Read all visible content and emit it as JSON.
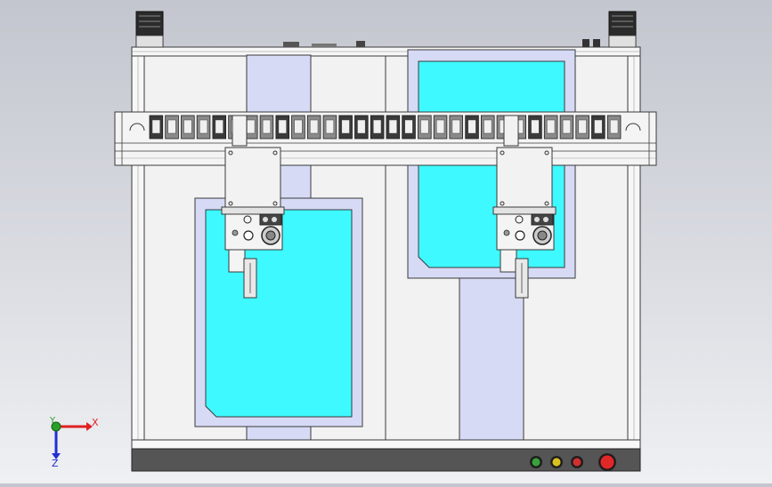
{
  "viewport": {
    "background": "#d4d6dc",
    "frame_color": "#f2f2f2",
    "outline_color": "#3a3a3a",
    "tray_fill": "#d7daf5",
    "work_fill": "#3ef9ff",
    "plate_fill": "#e9e9e9",
    "base_fill": "#555555"
  },
  "triad": {
    "x_label": "X",
    "z_label": "Z",
    "y_label": "Y",
    "x_color": "#e02020",
    "y_color": "#2aa02a",
    "z_color": "#2030d0"
  },
  "indicators": [
    {
      "name": "green-lamp",
      "color": "#3aa23a"
    },
    {
      "name": "yellow-lamp",
      "color": "#d8c020"
    },
    {
      "name": "red-lamp",
      "color": "#d03030"
    },
    {
      "name": "emergency-stop",
      "color": "#e02828"
    }
  ],
  "gantry": {
    "chain_links": 30,
    "heads": 2
  }
}
